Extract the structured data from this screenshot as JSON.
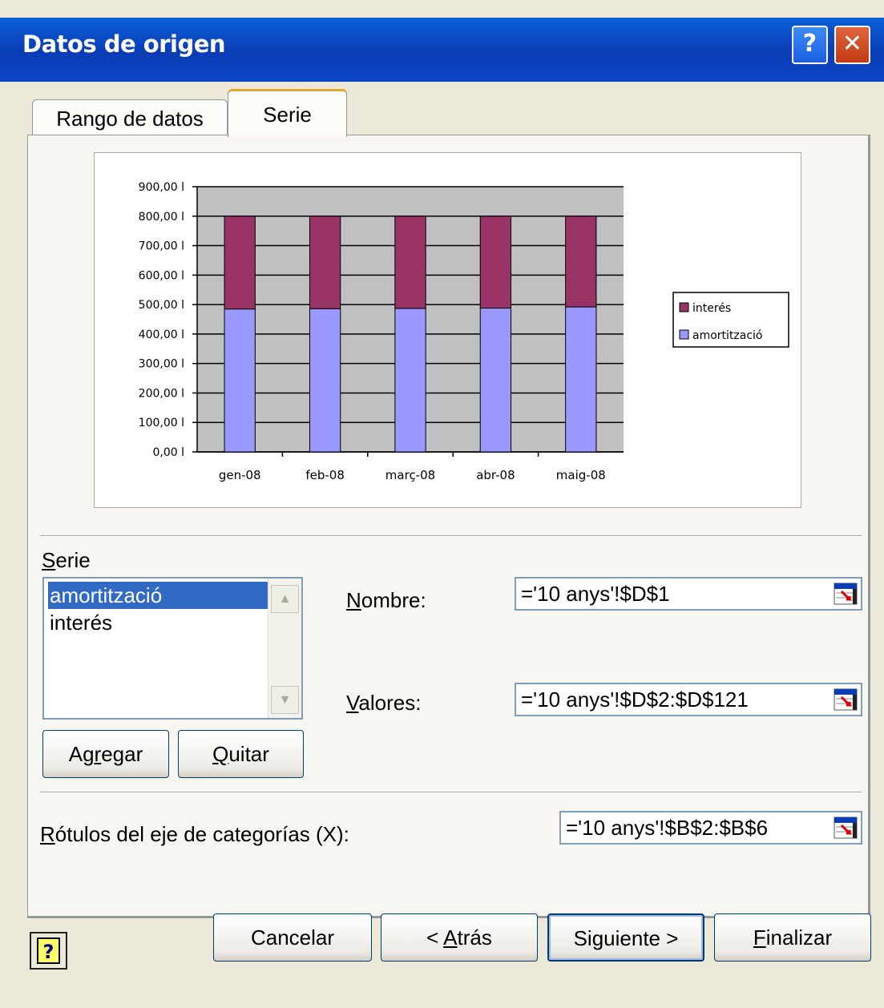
{
  "window": {
    "title": "Datos de origen",
    "help_glyph": "?",
    "close_glyph": "✕"
  },
  "tabs": [
    {
      "label": "Rango de datos",
      "active": false
    },
    {
      "label": "Serie",
      "active": true
    }
  ],
  "chart_data": {
    "type": "bar",
    "stacked": true,
    "categories": [
      "gen-08",
      "feb-08",
      "març-08",
      "abr-08",
      "maig-08"
    ],
    "series": [
      {
        "name": "amortització",
        "color": "#9999ff",
        "values": [
          485,
          486,
          487,
          488,
          492
        ]
      },
      {
        "name": "interés",
        "color": "#993366",
        "values": [
          315,
          314,
          313,
          312,
          308
        ]
      }
    ],
    "y_ticks": [
      "0,00 l",
      "100,00 l",
      "200,00 l",
      "300,00 l",
      "400,00 l",
      "500,00 l",
      "600,00 l",
      "700,00 l",
      "800,00 l",
      "900,00 l"
    ],
    "ylim": [
      0,
      900
    ],
    "grid": true,
    "plot_background": "#c0c0c0",
    "legend_position": "right",
    "legend_order": [
      "interés",
      "amortització"
    ]
  },
  "series_section": {
    "label_prefix": "",
    "label_underlined": "S",
    "label_rest": "erie",
    "items": [
      "amortització",
      "interés"
    ],
    "selected_index": 0,
    "scroll_up": "▲",
    "scroll_down": "▼"
  },
  "fields": {
    "nombre_u": "N",
    "nombre_rest": "ombre:",
    "nombre_value": "='10 anys'!$D$1",
    "valores_u": "V",
    "valores_rest": "alores:",
    "valores_value": "='10 anys'!$D$2:$D$121",
    "rotulos_u": "R",
    "rotulos_rest": "ótulos del eje de categorías (X):",
    "rotulos_value": "='10 anys'!$B$2:$B$6"
  },
  "buttons": {
    "agregar_pre": "Ag",
    "agregar_u": "r",
    "agregar_post": "egar",
    "quitar_u": "Q",
    "quitar_post": "uitar",
    "cancelar": "Cancelar",
    "atras_pre": "< ",
    "atras_u": "A",
    "atras_post": "trás",
    "siguiente": "Siguiente >",
    "finalizar_u": "F",
    "finalizar_post": "inalizar"
  }
}
